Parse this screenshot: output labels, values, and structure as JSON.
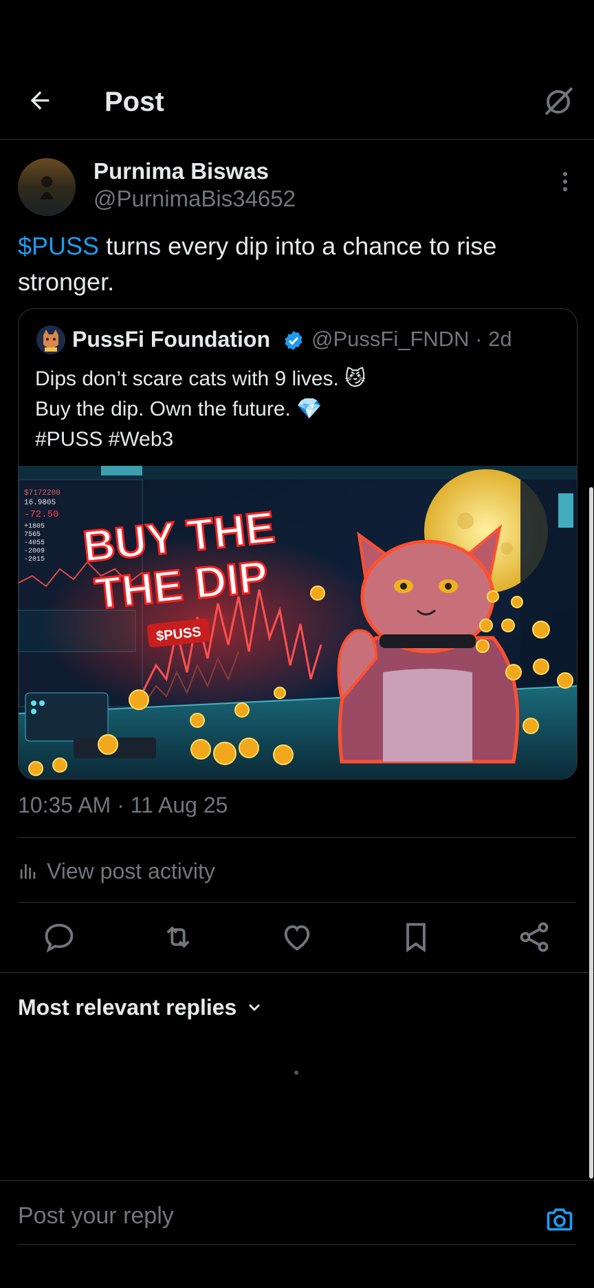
{
  "header": {
    "title": "Post"
  },
  "post": {
    "author_name": "Purnima Biswas",
    "author_handle": "@PurnimaBis34652",
    "cashtag": "$PUSS",
    "text_rest": " turns every dip into a chance to rise stronger.",
    "timestamp": "10:35 AM · 11 Aug 25"
  },
  "quote": {
    "name": "PussFi Foundation",
    "handle_time": "@PussFi_FNDN · 2d",
    "text": "Dips don’t scare cats with 9 lives. 😼\n Buy the dip. Own the future. 💎\n#PUSS #Web3",
    "image": {
      "headline_1": "BUY THE",
      "headline_2": "THE DIP",
      "tag": "$PUSS",
      "ticker_values": [
        "$7172200",
        "16.9805",
        "-72.50",
        "+1805",
        "7565",
        "-4055",
        "-2009",
        "-2015"
      ]
    }
  },
  "activity": {
    "label": "View post activity"
  },
  "replies": {
    "label": "Most relevant replies"
  },
  "reply_box": {
    "placeholder": "Post your reply"
  },
  "colors": {
    "accent": "#1d9bf0",
    "muted": "#71767b",
    "border": "#2f3336",
    "background": "#000000"
  },
  "icons": [
    "back-arrow-icon",
    "grok-icon",
    "more-icon",
    "verified-icon",
    "activity-icon",
    "reply-icon",
    "repost-icon",
    "like-icon",
    "bookmark-icon",
    "share-icon",
    "chevron-down-icon",
    "camera-icon"
  ]
}
